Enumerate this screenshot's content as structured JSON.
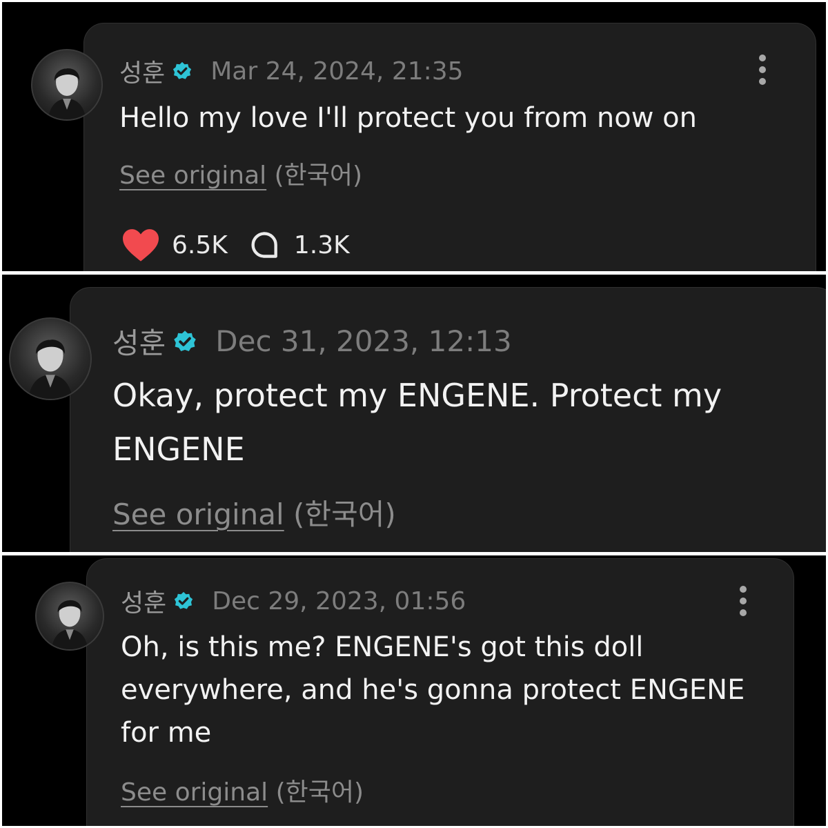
{
  "posts": [
    {
      "author": "성훈",
      "timestamp": "Mar 24, 2024, 21:35",
      "text": "Hello my love I'll protect you from now on",
      "see_original": "See original",
      "language": "(한국어)",
      "likes": "6.5K",
      "comments": "1.3K"
    },
    {
      "author": "성훈",
      "timestamp": "Dec 31, 2023, 12:13",
      "text": "Okay, protect my ENGENE. Protect my ENGENE",
      "see_original": "See original",
      "language": "(한국어)"
    },
    {
      "author": "성훈",
      "timestamp": "Dec 29, 2023, 01:56",
      "text": "Oh, is this me? ENGENE's got this doll everywhere, and he's gonna protect ENGENE for me",
      "see_original": "See original",
      "language": "(한국어)"
    }
  ],
  "icons": {
    "verified": "verified-badge-icon",
    "like": "heart-icon",
    "comment": "comment-bubble-icon",
    "more": "more-vertical-icon"
  },
  "colors": {
    "background": "#000000",
    "card": "#1e1e1e",
    "verified": "#2ec4d6",
    "heart": "#f24a4f",
    "text": "#f2f2f2",
    "muted": "#8c8c8c"
  }
}
